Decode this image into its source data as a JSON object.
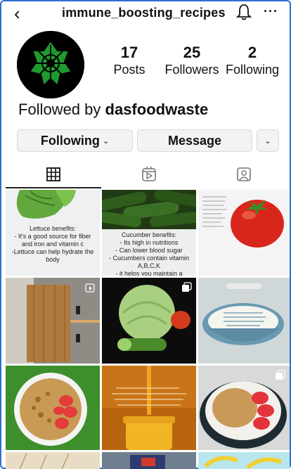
{
  "header": {
    "username": "immune_boosting_recipes",
    "back_icon": "chevron-left-icon",
    "bell_icon": "bell-icon",
    "more_icon": "more-horizontal-icon",
    "more_glyph": "···"
  },
  "profile": {
    "stats": [
      {
        "value": "17",
        "label": "Posts"
      },
      {
        "value": "25",
        "label": "Followers"
      },
      {
        "value": "2",
        "label": "Following"
      }
    ],
    "followed_prefix": "Followed by ",
    "followed_name": "dasfoodwaste"
  },
  "actions": {
    "following_label": "Following",
    "message_label": "Message"
  },
  "tabs": [
    {
      "name": "grid",
      "icon": "grid-icon",
      "active": true
    },
    {
      "name": "reels",
      "icon": "reels-icon",
      "active": false
    },
    {
      "name": "tagged",
      "icon": "tagged-icon",
      "active": false
    }
  ],
  "posts": [
    {
      "caption": [
        "Lettuce benefits:",
        "- It's a good source for fiber",
        "and iron and vitamin c",
        "-Lettuce can help hydrate the",
        "body"
      ]
    },
    {
      "caption": [
        "Cucumber benefits:",
        "- Its high in nutritions",
        "- Can lower blood sugar",
        "- Cucumbers contain vitamin",
        "A,B,C,K",
        "- it helps you maintain a"
      ]
    }
  ],
  "colors": {
    "accent_green": "#1f9a2f",
    "frame_blue": "#2b6fd6",
    "button_bg": "#f3f3f3"
  }
}
